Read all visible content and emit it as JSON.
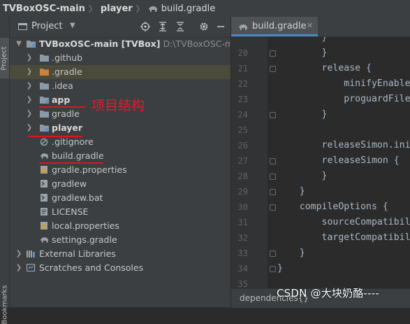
{
  "breadcrumb": {
    "project": "TVBoxOSC-main",
    "module": "player",
    "file": "build.gradle"
  },
  "left_strip": {
    "project_tab": "Project",
    "bookmarks_tab": "Bookmarks"
  },
  "project_panel": {
    "title": "Project",
    "toolbar_icons": [
      "target-icon",
      "expand-all-icon",
      "collapse-all-icon",
      "gear-icon",
      "minimize-icon"
    ],
    "tree": [
      {
        "label": "TVBoxOSC-main [TVBox]",
        "hint": "D:\\TVBoxOSC-main",
        "depth": 0,
        "arrow": "down",
        "icon": "folder-module-icon",
        "bold": true
      },
      {
        "label": ".github",
        "depth": 1,
        "arrow": "right",
        "icon": "folder-icon"
      },
      {
        "label": ".gradle",
        "depth": 1,
        "arrow": "right",
        "icon": "folder-orange-icon",
        "selected": true
      },
      {
        "label": ".idea",
        "depth": 1,
        "arrow": "right",
        "icon": "folder-icon"
      },
      {
        "label": "app",
        "depth": 1,
        "arrow": "right",
        "icon": "folder-module-icon",
        "bold": true
      },
      {
        "label": "gradle",
        "depth": 1,
        "arrow": "right",
        "icon": "folder-icon"
      },
      {
        "label": "player",
        "depth": 1,
        "arrow": "right",
        "icon": "folder-module-icon",
        "bold": true
      },
      {
        "label": ".gitignore",
        "depth": 1,
        "arrow": "",
        "icon": "gitignore-icon"
      },
      {
        "label": "build.gradle",
        "depth": 1,
        "arrow": "",
        "icon": "gradle-elephant-icon"
      },
      {
        "label": "gradle.properties",
        "depth": 1,
        "arrow": "",
        "icon": "properties-icon"
      },
      {
        "label": "gradlew",
        "depth": 1,
        "arrow": "",
        "icon": "script-icon"
      },
      {
        "label": "gradlew.bat",
        "depth": 1,
        "arrow": "",
        "icon": "script-icon"
      },
      {
        "label": "LICENSE",
        "depth": 1,
        "arrow": "",
        "icon": "text-file-icon"
      },
      {
        "label": "local.properties",
        "depth": 1,
        "arrow": "",
        "icon": "properties-icon"
      },
      {
        "label": "settings.gradle",
        "depth": 1,
        "arrow": "",
        "icon": "gradle-elephant-icon"
      },
      {
        "label": "External Libraries",
        "depth": 0,
        "arrow": "right",
        "icon": "libraries-icon"
      },
      {
        "label": "Scratches and Consoles",
        "depth": 0,
        "arrow": "right",
        "icon": "scratches-icon"
      }
    ],
    "annotation": "项目结构"
  },
  "editor": {
    "tab_label": "build.gradle",
    "status_breadcrumb": "dependencies{}",
    "lines": [
      {
        "n": "",
        "code": "        }"
      },
      {
        "n": "20",
        "code": "        }"
      },
      {
        "n": "21",
        "code": "        release {"
      },
      {
        "n": "22",
        "code": "            minifyEnable"
      },
      {
        "n": "23",
        "code": "            proguardFile"
      },
      {
        "n": "24",
        "code": "        }"
      },
      {
        "n": "25",
        "code": ""
      },
      {
        "n": "26",
        "code": "        releaseSimon.ini"
      },
      {
        "n": "27",
        "code": "        releaseSimon {"
      },
      {
        "n": "28",
        "code": "        }"
      },
      {
        "n": "29",
        "code": "    }"
      },
      {
        "n": "30",
        "code": "    compileOptions {"
      },
      {
        "n": "31",
        "code": "        sourceCompatibil"
      },
      {
        "n": "32",
        "code": "        targetCompatibil"
      },
      {
        "n": "33",
        "code": "    }"
      },
      {
        "n": "34",
        "code": "}"
      },
      {
        "n": "35",
        "code": ""
      }
    ]
  },
  "watermark": "CSDN @大块奶酪----",
  "colors": {
    "panel_bg": "#3c3f41",
    "editor_bg": "#2b2b2b",
    "selection": "#4b4b3c",
    "annotation_red": "#e8192c",
    "keyword_text": "#a9b7c6"
  }
}
